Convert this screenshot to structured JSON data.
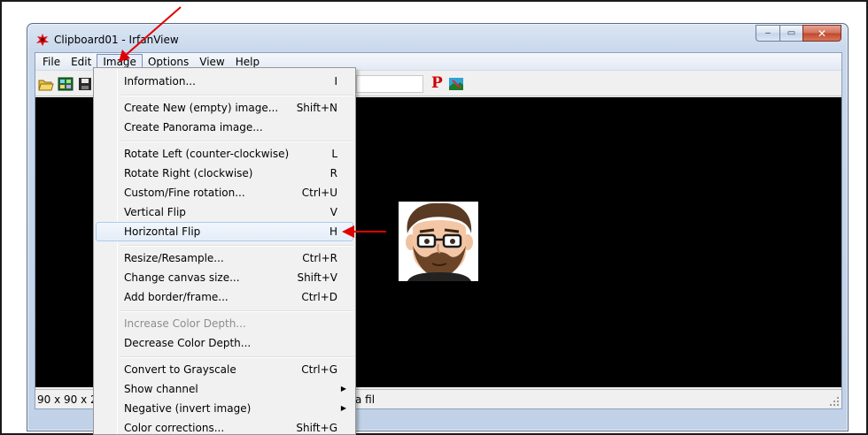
{
  "window": {
    "title": "Clipboard01 - IrfanView",
    "controls": {
      "minimize": "–",
      "maximize": "▭",
      "close": "✕"
    }
  },
  "menubar": {
    "items": [
      {
        "label": "File"
      },
      {
        "label": "Edit"
      },
      {
        "label": "Image",
        "active": true
      },
      {
        "label": "Options"
      },
      {
        "label": "View"
      },
      {
        "label": "Help"
      }
    ]
  },
  "toolbar": {
    "icons": [
      "open-folder-icon",
      "thumbnails-icon",
      "save-icon"
    ],
    "p_label": "P",
    "paint_icon": "paint-icon"
  },
  "status": {
    "dimensions": "90 x 90 x 24 B",
    "file_fragment": "a fil"
  },
  "image_menu": {
    "items": [
      {
        "label": "Information...",
        "shortcut": "I"
      },
      {
        "separator": true
      },
      {
        "label": "Create New (empty) image...",
        "shortcut": "Shift+N"
      },
      {
        "label": "Create Panorama image...",
        "shortcut": ""
      },
      {
        "separator": true
      },
      {
        "label": "Rotate Left (counter-clockwise)",
        "shortcut": "L"
      },
      {
        "label": "Rotate Right (clockwise)",
        "shortcut": "R"
      },
      {
        "label": "Custom/Fine rotation...",
        "shortcut": "Ctrl+U"
      },
      {
        "label": "Vertical Flip",
        "shortcut": "V"
      },
      {
        "label": "Horizontal Flip",
        "shortcut": "H",
        "highlighted": true
      },
      {
        "separator": true
      },
      {
        "label": "Resize/Resample...",
        "shortcut": "Ctrl+R"
      },
      {
        "label": "Change canvas size...",
        "shortcut": "Shift+V"
      },
      {
        "label": "Add border/frame...",
        "shortcut": "Ctrl+D"
      },
      {
        "separator": true
      },
      {
        "label": "Increase Color Depth...",
        "shortcut": "",
        "disabled": true
      },
      {
        "label": "Decrease Color Depth...",
        "shortcut": ""
      },
      {
        "separator": true
      },
      {
        "label": "Convert to Grayscale",
        "shortcut": "Ctrl+G"
      },
      {
        "label": "Show channel",
        "shortcut": "",
        "submenu": true
      },
      {
        "label": "Negative (invert image)",
        "shortcut": "",
        "submenu": true
      },
      {
        "label": "Color corrections...",
        "shortcut": "Shift+G"
      }
    ]
  },
  "colors": {
    "annotation_arrow": "#e00000",
    "viewer_background": "#000000",
    "menu_highlight_border": "#aecbf1"
  }
}
